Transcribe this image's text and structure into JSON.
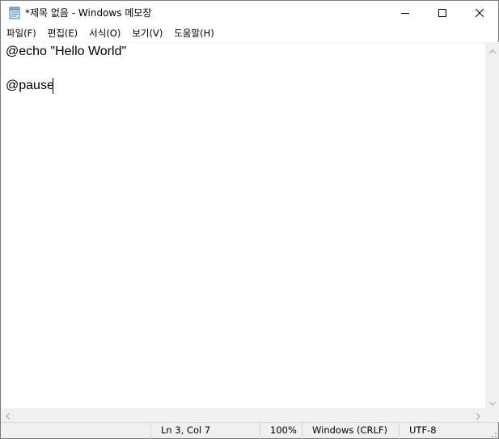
{
  "window": {
    "title": "*제목 없음 - Windows 메모장",
    "icon": "notepad-icon"
  },
  "caption_buttons": {
    "minimize": "minimize-icon",
    "maximize": "maximize-icon",
    "close": "close-icon"
  },
  "menu": {
    "items": [
      {
        "label": "파일(F)"
      },
      {
        "label": "편집(E)"
      },
      {
        "label": "서식(O)"
      },
      {
        "label": "보기(V)"
      },
      {
        "label": "도움말(H)"
      }
    ]
  },
  "editor": {
    "lines": [
      "@echo \"Hello World\"",
      "",
      "@pause"
    ]
  },
  "status": {
    "position": "Ln 3, Col 7",
    "zoom": "100%",
    "line_ending": "Windows (CRLF)",
    "encoding": "UTF-8"
  },
  "colors": {
    "scrollbar_bg": "#f0f0f0",
    "status_bg": "#f0f0f0",
    "text": "#000000"
  }
}
